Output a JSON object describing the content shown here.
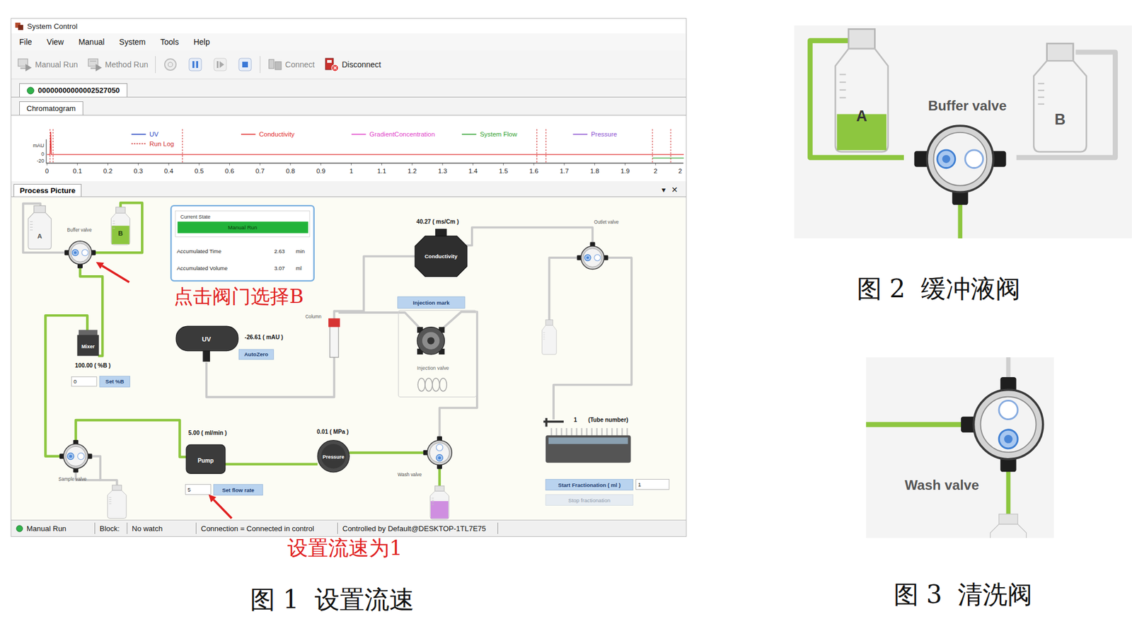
{
  "window": {
    "title": "System Control"
  },
  "menu": [
    "File",
    "View",
    "Manual",
    "System",
    "Tools",
    "Help"
  ],
  "toolbar": [
    {
      "kind": "manual",
      "label": "Manual Run",
      "disabled": true
    },
    {
      "kind": "method",
      "label": "Method Run",
      "disabled": true
    },
    {
      "kind": "record",
      "disabled": true
    },
    {
      "kind": "pause",
      "disabled": false
    },
    {
      "kind": "step",
      "disabled": true
    },
    {
      "kind": "stop",
      "disabled": false
    },
    {
      "kind": "connect",
      "label": "Connect",
      "disabled": true
    },
    {
      "kind": "disconnect",
      "label": "Disconnect",
      "disabled": false
    }
  ],
  "device_tab": {
    "label": "00000000000002527050",
    "connected": true,
    "selected": true
  },
  "view_tab": {
    "label": "Chromatogram",
    "selected": true
  },
  "chart": {
    "unit": "mAU",
    "y_ticks": [
      {
        "label": "0",
        "value": 0
      },
      {
        "label": "-20",
        "value": -20
      }
    ],
    "x_ticks": [
      "0",
      "0.1",
      "0.2",
      "0.3",
      "0.4",
      "0.5",
      "0.6",
      "0.7",
      "0.8",
      "0.9",
      "1",
      "1.1",
      "1.2",
      "1.3",
      "1.4",
      "1.5",
      "1.6",
      "1.7",
      "1.8",
      "1.9",
      "2",
      "2"
    ],
    "series": [
      {
        "name": "UV",
        "kind": "line",
        "color": "#1f3fbf",
        "points": []
      },
      {
        "name": "Run Log",
        "kind": "marks",
        "color": "#d03030",
        "marks": [
          0.01,
          0.02,
          0.445,
          1.61,
          1.64,
          1.99,
          2.05
        ]
      },
      {
        "name": "Conductivity",
        "kind": "line",
        "color": "#e02828",
        "points": [
          [
            0,
            0
          ],
          [
            0.01,
            0
          ],
          [
            0.012,
            90
          ],
          [
            0.014,
            0
          ],
          [
            2.1,
            0
          ]
        ]
      },
      {
        "name": "GradientConcentration",
        "kind": "line",
        "color": "#e040c8",
        "points": []
      },
      {
        "name": "System Flow",
        "kind": "line",
        "color": "#2ea02e",
        "points": [
          [
            1.99,
            -14
          ],
          [
            2.1,
            -14
          ]
        ]
      },
      {
        "name": "Pressure",
        "kind": "line",
        "color": "#8a4fd0",
        "points": []
      }
    ]
  },
  "panel": {
    "title": "Process Picture",
    "menu_glyph": "▾",
    "close_glyph": "✕"
  },
  "process": {
    "current_state": {
      "title": "Current State",
      "state": "Manual Run",
      "rows": [
        {
          "label": "Accumulated Time",
          "value": "2.63",
          "unit": "min"
        },
        {
          "label": "Accumulated Volume",
          "value": "3.07",
          "unit": "ml"
        }
      ]
    },
    "buffer_bottles": [
      {
        "label": "A",
        "level": 0,
        "color": "#f2f2f2"
      },
      {
        "label": "B",
        "level": 0.7,
        "color": "#8dc63f"
      }
    ],
    "outlet_bottle": {
      "level": 0,
      "color": "#f2f2f2"
    },
    "sample_bottle": {
      "level": 0,
      "color": "#f2f2f2"
    },
    "wash_bottle": {
      "level": 0.75,
      "color": "#cf8ee0"
    },
    "buffer_valve": {
      "label": "Buffer valve",
      "ports": [
        {
          "selected": true
        },
        {
          "selected": false
        }
      ]
    },
    "sample_valve": {
      "label": "Sample valve",
      "ports": [
        {
          "selected": true
        },
        {
          "selected": false
        }
      ]
    },
    "wash_valve": {
      "label": "Wash valve",
      "ports": [
        {
          "selected": false
        },
        {
          "selected": true
        }
      ]
    },
    "outlet_valve": {
      "label": "Outlet valve",
      "ports": [
        {
          "selected": true
        },
        {
          "selected": false
        }
      ]
    },
    "mixer": {
      "label": "Mixer",
      "reading": "100.00 ( %B )",
      "input": "0",
      "button": "Set %B"
    },
    "conductivity": {
      "label": "Conductivity",
      "reading": "40.27 ( ms/Cm )"
    },
    "uv": {
      "label": "UV",
      "reading": "-26.61 ( mAU )",
      "button": "AutoZero"
    },
    "column": {
      "label": "Column"
    },
    "injection_mark": "Injection mark",
    "injection_valve": {
      "label": "Injection valve"
    },
    "pump": {
      "label": "Pump",
      "reading": "5.00 ( ml/min )",
      "input": "5",
      "button": "Set flow rate"
    },
    "pressure": {
      "label": "Pressure",
      "reading": "0.01 ( MPa )"
    },
    "fraction": {
      "tube": "1",
      "tube_label": "(Tube number)",
      "start_button": "Start Fractionation ( ml )",
      "input": "1",
      "stop_button": "Stop fractionation",
      "stop_disabled": true
    }
  },
  "annotations": [
    {
      "text": "点击阀门选择B"
    },
    {
      "text": "设置流速为1"
    }
  ],
  "status_bar": {
    "mode": "Manual Run",
    "connected": true,
    "cells": [
      "Block:",
      "No watch",
      "Connection = Connected in control",
      "Controlled by Default@DESKTOP-1TL7E75"
    ]
  },
  "fig1": {
    "caption": "图 1  设置流速"
  },
  "fig2": {
    "caption": "图 2  缓冲液阀",
    "valve_label": "Buffer valve",
    "bottles": [
      {
        "label": "A",
        "level": 0.42,
        "color": "#8dc63f"
      },
      {
        "label": "B",
        "level": 0,
        "color": "#e6e6e6"
      }
    ],
    "ports": [
      {
        "selected": true
      },
      {
        "selected": false
      }
    ]
  },
  "fig3": {
    "caption": "图 3  清洗阀",
    "valve_label": "Wash valve",
    "ports": [
      {
        "selected": false
      },
      {
        "selected": true
      }
    ]
  }
}
